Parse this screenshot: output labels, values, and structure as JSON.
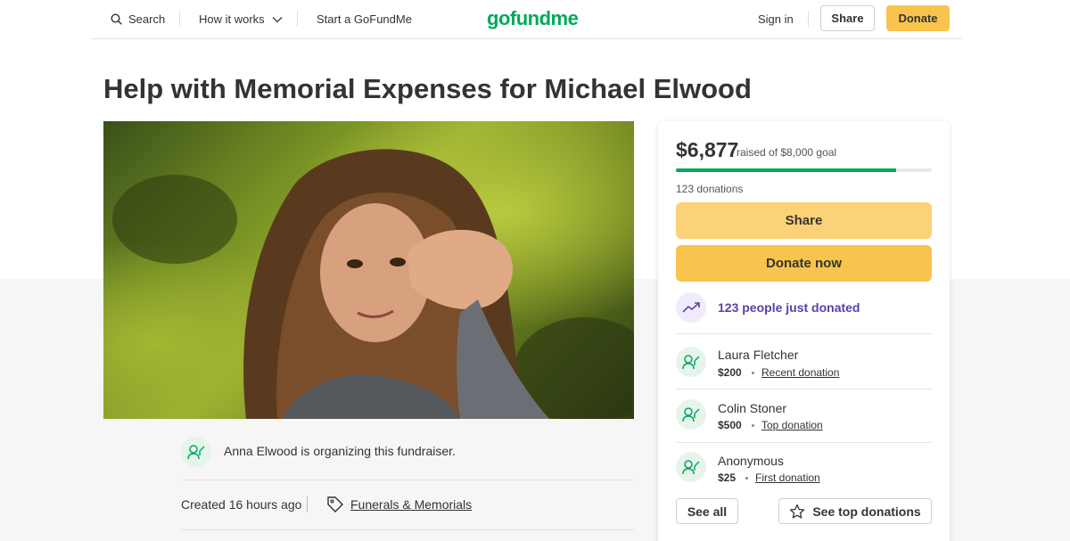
{
  "nav": {
    "search_label": "Search",
    "how_it_works_label": "How it works",
    "start_label": "Start a GoFundMe",
    "logo_text": "gofundme",
    "sign_in_label": "Sign in",
    "share_label": "Share",
    "donate_label": "Donate"
  },
  "campaign": {
    "title": "Help with Memorial Expenses for Michael Elwood",
    "organizer_text": "Anna Elwood is organizing this fundraiser.",
    "created_text": "Created 16 hours ago",
    "category_text": "Funerals & Memorials"
  },
  "progress": {
    "raised": "$6,877",
    "goal_text": "raised of $8,000 goal",
    "fraction": 0.86,
    "donation_count_text": "123 donations"
  },
  "actions": {
    "share_label": "Share",
    "donate_label": "Donate now"
  },
  "recent_activity_text": "123 people just donated",
  "donations": [
    {
      "name": "Laura Fletcher",
      "amount": "$200",
      "tag": "Recent donation"
    },
    {
      "name": "Colin Stoner",
      "amount": "$500",
      "tag": "Top donation"
    },
    {
      "name": "Anonymous",
      "amount": "$25",
      "tag": "First donation"
    }
  ],
  "footer_buttons": {
    "see_all_label": "See all",
    "see_top_label": "See top donations"
  },
  "colors": {
    "brand_green": "#02a95c",
    "donate_yellow": "#f8c44d",
    "share_yellow": "#fbd277",
    "activity_purple": "#5b3fa6"
  }
}
